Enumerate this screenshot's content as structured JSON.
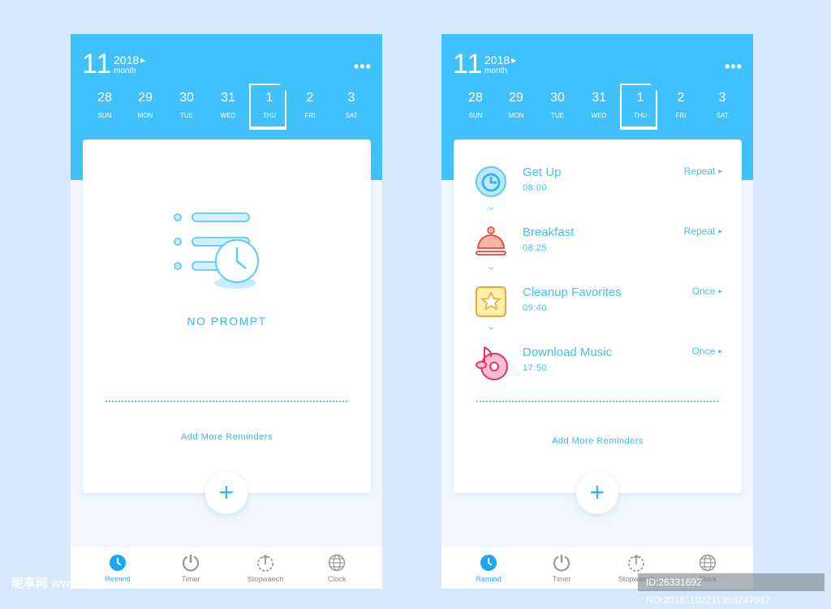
{
  "header": {
    "day": "11",
    "year": "2018",
    "month_label": "month",
    "more": "•••"
  },
  "week": [
    {
      "num": "28",
      "day": "SUN"
    },
    {
      "num": "29",
      "day": "MON"
    },
    {
      "num": "30",
      "day": "TUE"
    },
    {
      "num": "31",
      "day": "WED"
    },
    {
      "num": "1",
      "day": "THU",
      "selected": true
    },
    {
      "num": "2",
      "day": "FRI"
    },
    {
      "num": "3",
      "day": "SAT"
    }
  ],
  "empty_state": {
    "message": "NO PROMPT"
  },
  "add_more": "Add More Reminders",
  "plus": "+",
  "reminders": [
    {
      "title": "Get Up",
      "time": "08:00",
      "repeat": "Repeat",
      "icon": "alarm-clock-icon"
    },
    {
      "title": "Breakfast",
      "time": "08:25",
      "repeat": "Repeat",
      "icon": "food-cloche-icon"
    },
    {
      "title": "Cleanup Favorites",
      "time": "09:40",
      "repeat": "Once",
      "icon": "star-folder-icon"
    },
    {
      "title": "Download Music",
      "time": "17:50",
      "repeat": "Once",
      "icon": "music-disc-icon"
    }
  ],
  "tabs": [
    {
      "label": "Remind",
      "icon": "clock-icon",
      "active": true
    },
    {
      "label": "Timer",
      "icon": "timer-icon"
    },
    {
      "label": "Stopwaech",
      "icon": "stopwatch-icon"
    },
    {
      "label": "Clock",
      "icon": "globe-icon"
    }
  ],
  "watermark": {
    "logo": "昵享网 www.nipic.cn",
    "id": "ID:26331692 NO:20181102211358247032"
  },
  "colors": {
    "primary": "#40c0fc",
    "background": "#d6e8fc",
    "accent_text": "#3ab4f0"
  }
}
